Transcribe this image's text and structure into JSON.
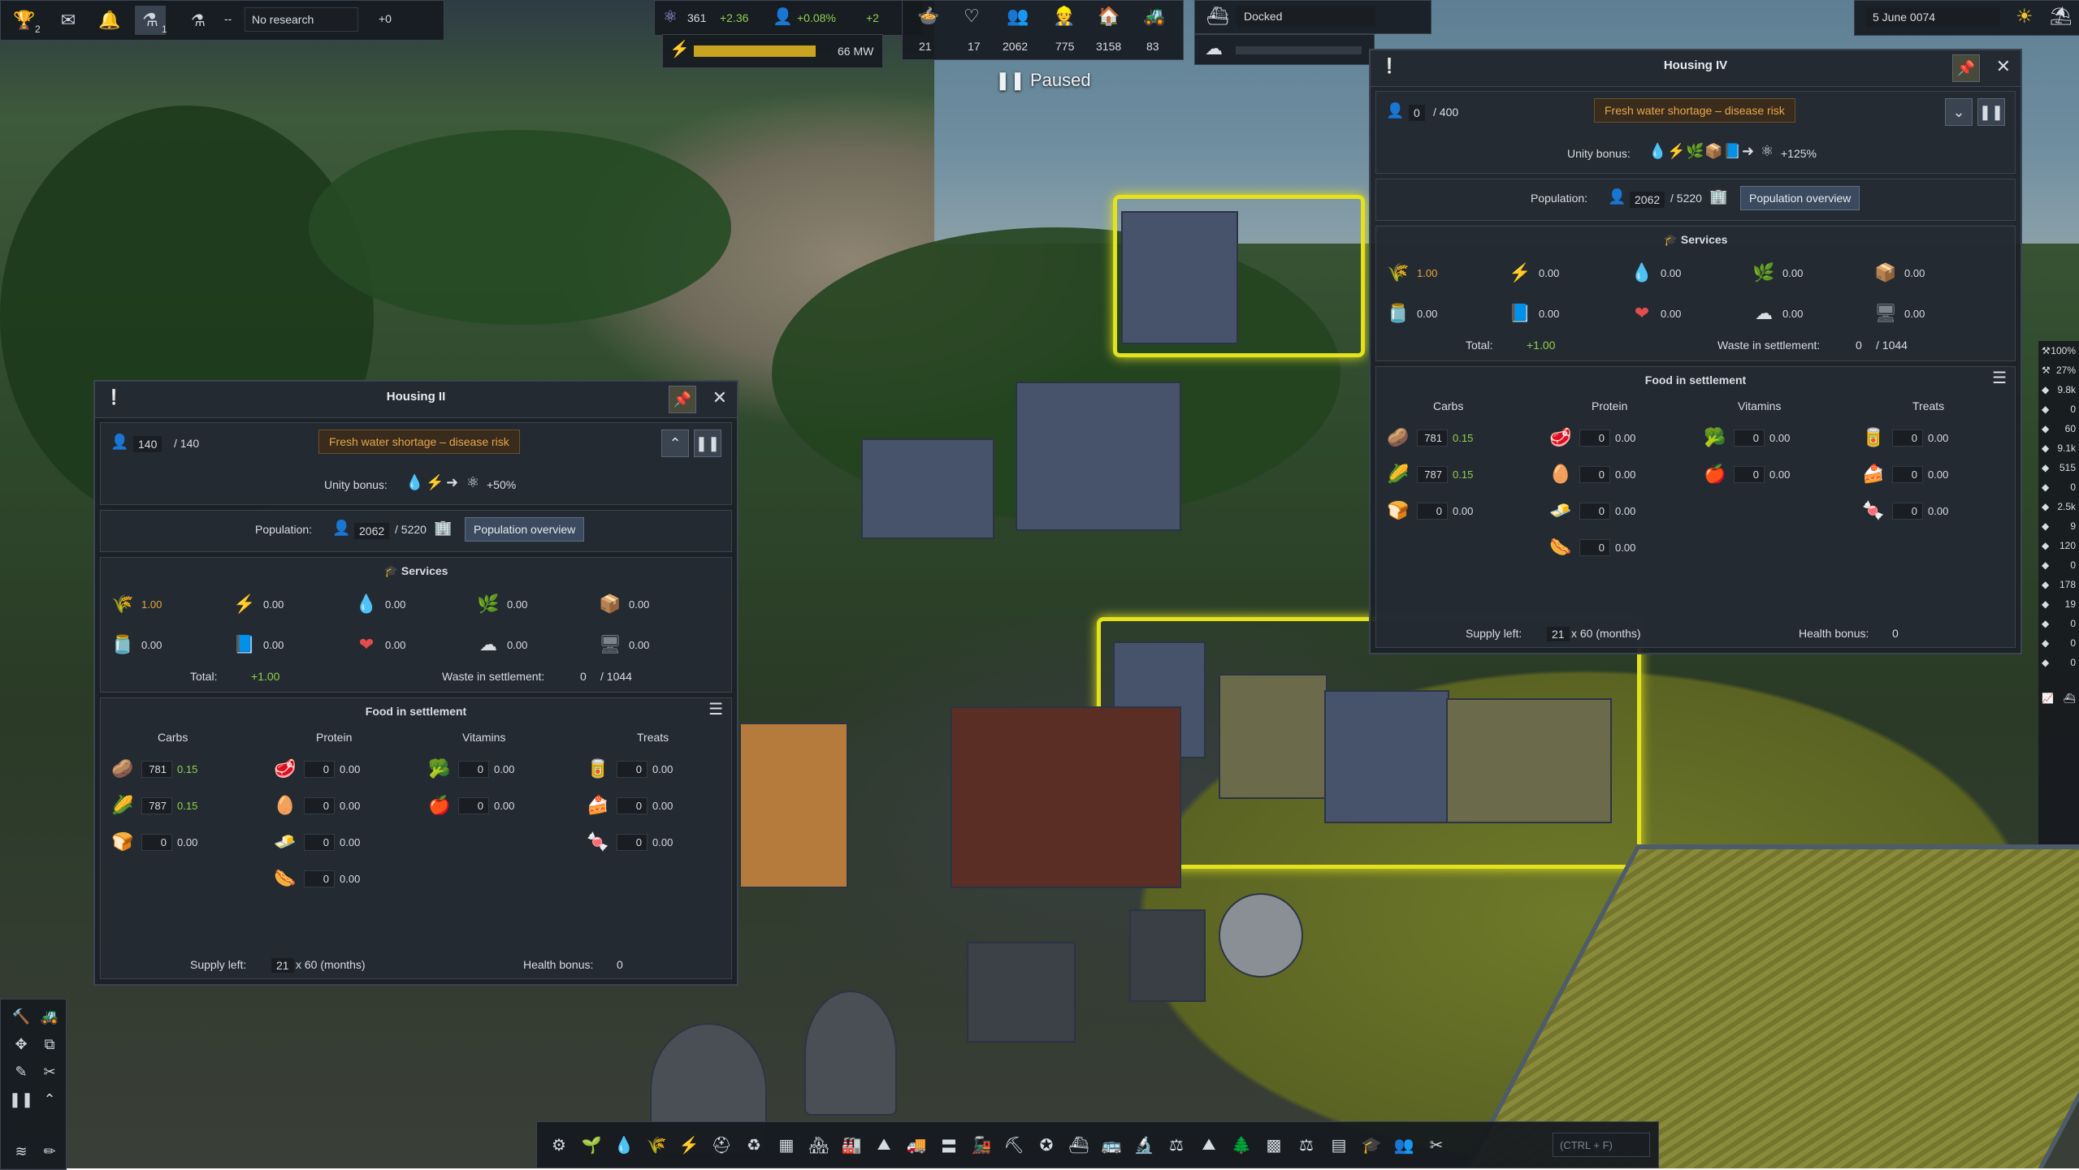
{
  "topbar": {
    "badges": {
      "trophy": "2",
      "research": "1"
    },
    "research_field": "No research",
    "research_dash": "--",
    "research_plus": "+0",
    "unity": "361",
    "unity_delta": "+2.36",
    "pop_growth": "+0.08%",
    "pop_delta": "+2",
    "power": "66 MW",
    "stats": [
      "21",
      "17",
      "2062",
      "775",
      "3158",
      "83"
    ],
    "ship_status": "Docked",
    "date": "5 June 0074"
  },
  "paused_label": "Paused",
  "panels": [
    {
      "title": "Housing II",
      "pop_current": "140",
      "pop_max": "/ 140",
      "alert": "Fresh water shortage – disease risk",
      "unity_bonus_label": "Unity bonus:",
      "unity_bonus_value": "+50%",
      "population_label": "Population:",
      "population_value": "2062",
      "population_max": "/ 5220",
      "population_button": "Population overview",
      "services_title": "Services",
      "services": [
        [
          "1.00",
          "0.00",
          "0.00",
          "0.00",
          "0.00"
        ],
        [
          "0.00",
          "0.00",
          "0.00",
          "0.00",
          "0.00"
        ]
      ],
      "total_label": "Total:",
      "total_value": "+1.00",
      "waste_label": "Waste in settlement:",
      "waste_value": "0",
      "waste_max": "/ 1044",
      "food_title": "Food in settlement",
      "food_headers": [
        "Carbs",
        "Protein",
        "Vitamins",
        "Treats"
      ],
      "carbs": [
        [
          "781",
          "0.15"
        ],
        [
          "787",
          "0.15"
        ],
        [
          "0",
          "0.00"
        ]
      ],
      "protein": [
        [
          "0",
          "0.00"
        ],
        [
          "0",
          "0.00"
        ],
        [
          "0",
          "0.00"
        ],
        [
          "0",
          "0.00"
        ]
      ],
      "vitamins": [
        [
          "0",
          "0.00"
        ],
        [
          "0",
          "0.00"
        ]
      ],
      "treats": [
        [
          "0",
          "0.00"
        ],
        [
          "0",
          "0.00"
        ],
        [
          "0",
          "0.00"
        ]
      ],
      "supply_label": "Supply left:",
      "supply_value": "21",
      "supply_unit": "x 60 (months)",
      "health_label": "Health bonus:",
      "health_value": "0"
    },
    {
      "title": "Housing IV",
      "pop_current": "0",
      "pop_max": "/ 400",
      "alert": "Fresh water shortage – disease risk",
      "unity_bonus_label": "Unity bonus:",
      "unity_bonus_value": "+125%",
      "population_label": "Population:",
      "population_value": "2062",
      "population_max": "/ 5220",
      "population_button": "Population overview",
      "services_title": "Services",
      "services": [
        [
          "1.00",
          "0.00",
          "0.00",
          "0.00",
          "0.00"
        ],
        [
          "0.00",
          "0.00",
          "0.00",
          "0.00",
          "0.00"
        ]
      ],
      "total_label": "Total:",
      "total_value": "+1.00",
      "waste_label": "Waste in settlement:",
      "waste_value": "0",
      "waste_max": "/ 1044",
      "food_title": "Food in settlement",
      "food_headers": [
        "Carbs",
        "Protein",
        "Vitamins",
        "Treats"
      ],
      "carbs": [
        [
          "781",
          "0.15"
        ],
        [
          "787",
          "0.15"
        ],
        [
          "0",
          "0.00"
        ]
      ],
      "protein": [
        [
          "0",
          "0.00"
        ],
        [
          "0",
          "0.00"
        ],
        [
          "0",
          "0.00"
        ],
        [
          "0",
          "0.00"
        ]
      ],
      "vitamins": [
        [
          "0",
          "0.00"
        ],
        [
          "0",
          "0.00"
        ]
      ],
      "treats": [
        [
          "0",
          "0.00"
        ],
        [
          "0",
          "0.00"
        ],
        [
          "0",
          "0.00"
        ]
      ],
      "supply_label": "Supply left:",
      "supply_value": "21",
      "supply_unit": "x 60 (months)",
      "health_label": "Health bonus:",
      "health_value": "0"
    }
  ],
  "right_sidebar": {
    "percents": [
      "100%",
      "27%"
    ],
    "values": [
      "9.8k",
      "0",
      "60",
      "9.1k",
      "515",
      "0",
      "2.5k",
      "9",
      "120",
      "0",
      "178",
      "19",
      "0",
      "0",
      "0"
    ]
  },
  "search_hint": "(CTRL + F)",
  "colors": {
    "accent_yellow": "#e3e21c",
    "alert_orange": "#e6a64a",
    "positive_green": "#8ed14d"
  }
}
